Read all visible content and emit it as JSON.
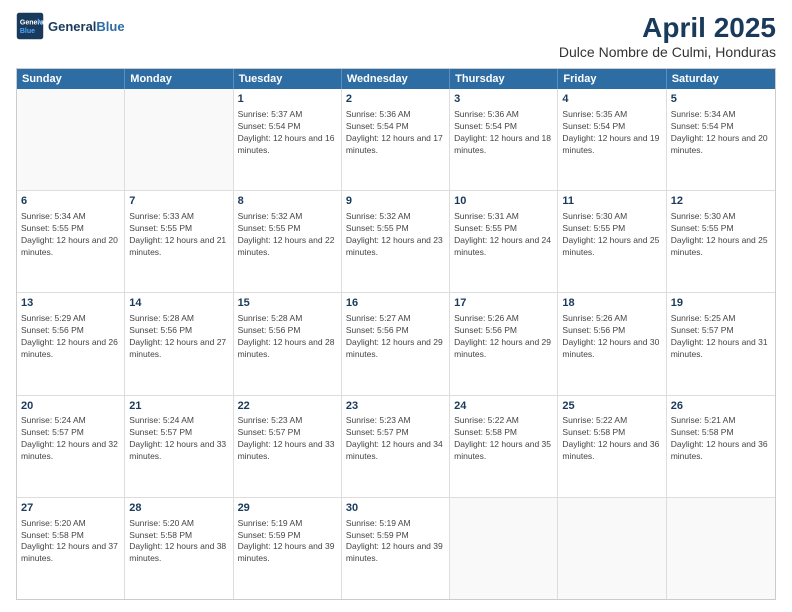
{
  "header": {
    "logo_line1": "General",
    "logo_line2": "Blue",
    "title": "April 2025",
    "subtitle": "Dulce Nombre de Culmi, Honduras"
  },
  "weekdays": [
    "Sunday",
    "Monday",
    "Tuesday",
    "Wednesday",
    "Thursday",
    "Friday",
    "Saturday"
  ],
  "weeks": [
    [
      {
        "day": "",
        "sunrise": "",
        "sunset": "",
        "daylight": ""
      },
      {
        "day": "",
        "sunrise": "",
        "sunset": "",
        "daylight": ""
      },
      {
        "day": "1",
        "sunrise": "Sunrise: 5:37 AM",
        "sunset": "Sunset: 5:54 PM",
        "daylight": "Daylight: 12 hours and 16 minutes."
      },
      {
        "day": "2",
        "sunrise": "Sunrise: 5:36 AM",
        "sunset": "Sunset: 5:54 PM",
        "daylight": "Daylight: 12 hours and 17 minutes."
      },
      {
        "day": "3",
        "sunrise": "Sunrise: 5:36 AM",
        "sunset": "Sunset: 5:54 PM",
        "daylight": "Daylight: 12 hours and 18 minutes."
      },
      {
        "day": "4",
        "sunrise": "Sunrise: 5:35 AM",
        "sunset": "Sunset: 5:54 PM",
        "daylight": "Daylight: 12 hours and 19 minutes."
      },
      {
        "day": "5",
        "sunrise": "Sunrise: 5:34 AM",
        "sunset": "Sunset: 5:54 PM",
        "daylight": "Daylight: 12 hours and 20 minutes."
      }
    ],
    [
      {
        "day": "6",
        "sunrise": "Sunrise: 5:34 AM",
        "sunset": "Sunset: 5:55 PM",
        "daylight": "Daylight: 12 hours and 20 minutes."
      },
      {
        "day": "7",
        "sunrise": "Sunrise: 5:33 AM",
        "sunset": "Sunset: 5:55 PM",
        "daylight": "Daylight: 12 hours and 21 minutes."
      },
      {
        "day": "8",
        "sunrise": "Sunrise: 5:32 AM",
        "sunset": "Sunset: 5:55 PM",
        "daylight": "Daylight: 12 hours and 22 minutes."
      },
      {
        "day": "9",
        "sunrise": "Sunrise: 5:32 AM",
        "sunset": "Sunset: 5:55 PM",
        "daylight": "Daylight: 12 hours and 23 minutes."
      },
      {
        "day": "10",
        "sunrise": "Sunrise: 5:31 AM",
        "sunset": "Sunset: 5:55 PM",
        "daylight": "Daylight: 12 hours and 24 minutes."
      },
      {
        "day": "11",
        "sunrise": "Sunrise: 5:30 AM",
        "sunset": "Sunset: 5:55 PM",
        "daylight": "Daylight: 12 hours and 25 minutes."
      },
      {
        "day": "12",
        "sunrise": "Sunrise: 5:30 AM",
        "sunset": "Sunset: 5:55 PM",
        "daylight": "Daylight: 12 hours and 25 minutes."
      }
    ],
    [
      {
        "day": "13",
        "sunrise": "Sunrise: 5:29 AM",
        "sunset": "Sunset: 5:56 PM",
        "daylight": "Daylight: 12 hours and 26 minutes."
      },
      {
        "day": "14",
        "sunrise": "Sunrise: 5:28 AM",
        "sunset": "Sunset: 5:56 PM",
        "daylight": "Daylight: 12 hours and 27 minutes."
      },
      {
        "day": "15",
        "sunrise": "Sunrise: 5:28 AM",
        "sunset": "Sunset: 5:56 PM",
        "daylight": "Daylight: 12 hours and 28 minutes."
      },
      {
        "day": "16",
        "sunrise": "Sunrise: 5:27 AM",
        "sunset": "Sunset: 5:56 PM",
        "daylight": "Daylight: 12 hours and 29 minutes."
      },
      {
        "day": "17",
        "sunrise": "Sunrise: 5:26 AM",
        "sunset": "Sunset: 5:56 PM",
        "daylight": "Daylight: 12 hours and 29 minutes."
      },
      {
        "day": "18",
        "sunrise": "Sunrise: 5:26 AM",
        "sunset": "Sunset: 5:56 PM",
        "daylight": "Daylight: 12 hours and 30 minutes."
      },
      {
        "day": "19",
        "sunrise": "Sunrise: 5:25 AM",
        "sunset": "Sunset: 5:57 PM",
        "daylight": "Daylight: 12 hours and 31 minutes."
      }
    ],
    [
      {
        "day": "20",
        "sunrise": "Sunrise: 5:24 AM",
        "sunset": "Sunset: 5:57 PM",
        "daylight": "Daylight: 12 hours and 32 minutes."
      },
      {
        "day": "21",
        "sunrise": "Sunrise: 5:24 AM",
        "sunset": "Sunset: 5:57 PM",
        "daylight": "Daylight: 12 hours and 33 minutes."
      },
      {
        "day": "22",
        "sunrise": "Sunrise: 5:23 AM",
        "sunset": "Sunset: 5:57 PM",
        "daylight": "Daylight: 12 hours and 33 minutes."
      },
      {
        "day": "23",
        "sunrise": "Sunrise: 5:23 AM",
        "sunset": "Sunset: 5:57 PM",
        "daylight": "Daylight: 12 hours and 34 minutes."
      },
      {
        "day": "24",
        "sunrise": "Sunrise: 5:22 AM",
        "sunset": "Sunset: 5:58 PM",
        "daylight": "Daylight: 12 hours and 35 minutes."
      },
      {
        "day": "25",
        "sunrise": "Sunrise: 5:22 AM",
        "sunset": "Sunset: 5:58 PM",
        "daylight": "Daylight: 12 hours and 36 minutes."
      },
      {
        "day": "26",
        "sunrise": "Sunrise: 5:21 AM",
        "sunset": "Sunset: 5:58 PM",
        "daylight": "Daylight: 12 hours and 36 minutes."
      }
    ],
    [
      {
        "day": "27",
        "sunrise": "Sunrise: 5:20 AM",
        "sunset": "Sunset: 5:58 PM",
        "daylight": "Daylight: 12 hours and 37 minutes."
      },
      {
        "day": "28",
        "sunrise": "Sunrise: 5:20 AM",
        "sunset": "Sunset: 5:58 PM",
        "daylight": "Daylight: 12 hours and 38 minutes."
      },
      {
        "day": "29",
        "sunrise": "Sunrise: 5:19 AM",
        "sunset": "Sunset: 5:59 PM",
        "daylight": "Daylight: 12 hours and 39 minutes."
      },
      {
        "day": "30",
        "sunrise": "Sunrise: 5:19 AM",
        "sunset": "Sunset: 5:59 PM",
        "daylight": "Daylight: 12 hours and 39 minutes."
      },
      {
        "day": "",
        "sunrise": "",
        "sunset": "",
        "daylight": ""
      },
      {
        "day": "",
        "sunrise": "",
        "sunset": "",
        "daylight": ""
      },
      {
        "day": "",
        "sunrise": "",
        "sunset": "",
        "daylight": ""
      }
    ]
  ]
}
